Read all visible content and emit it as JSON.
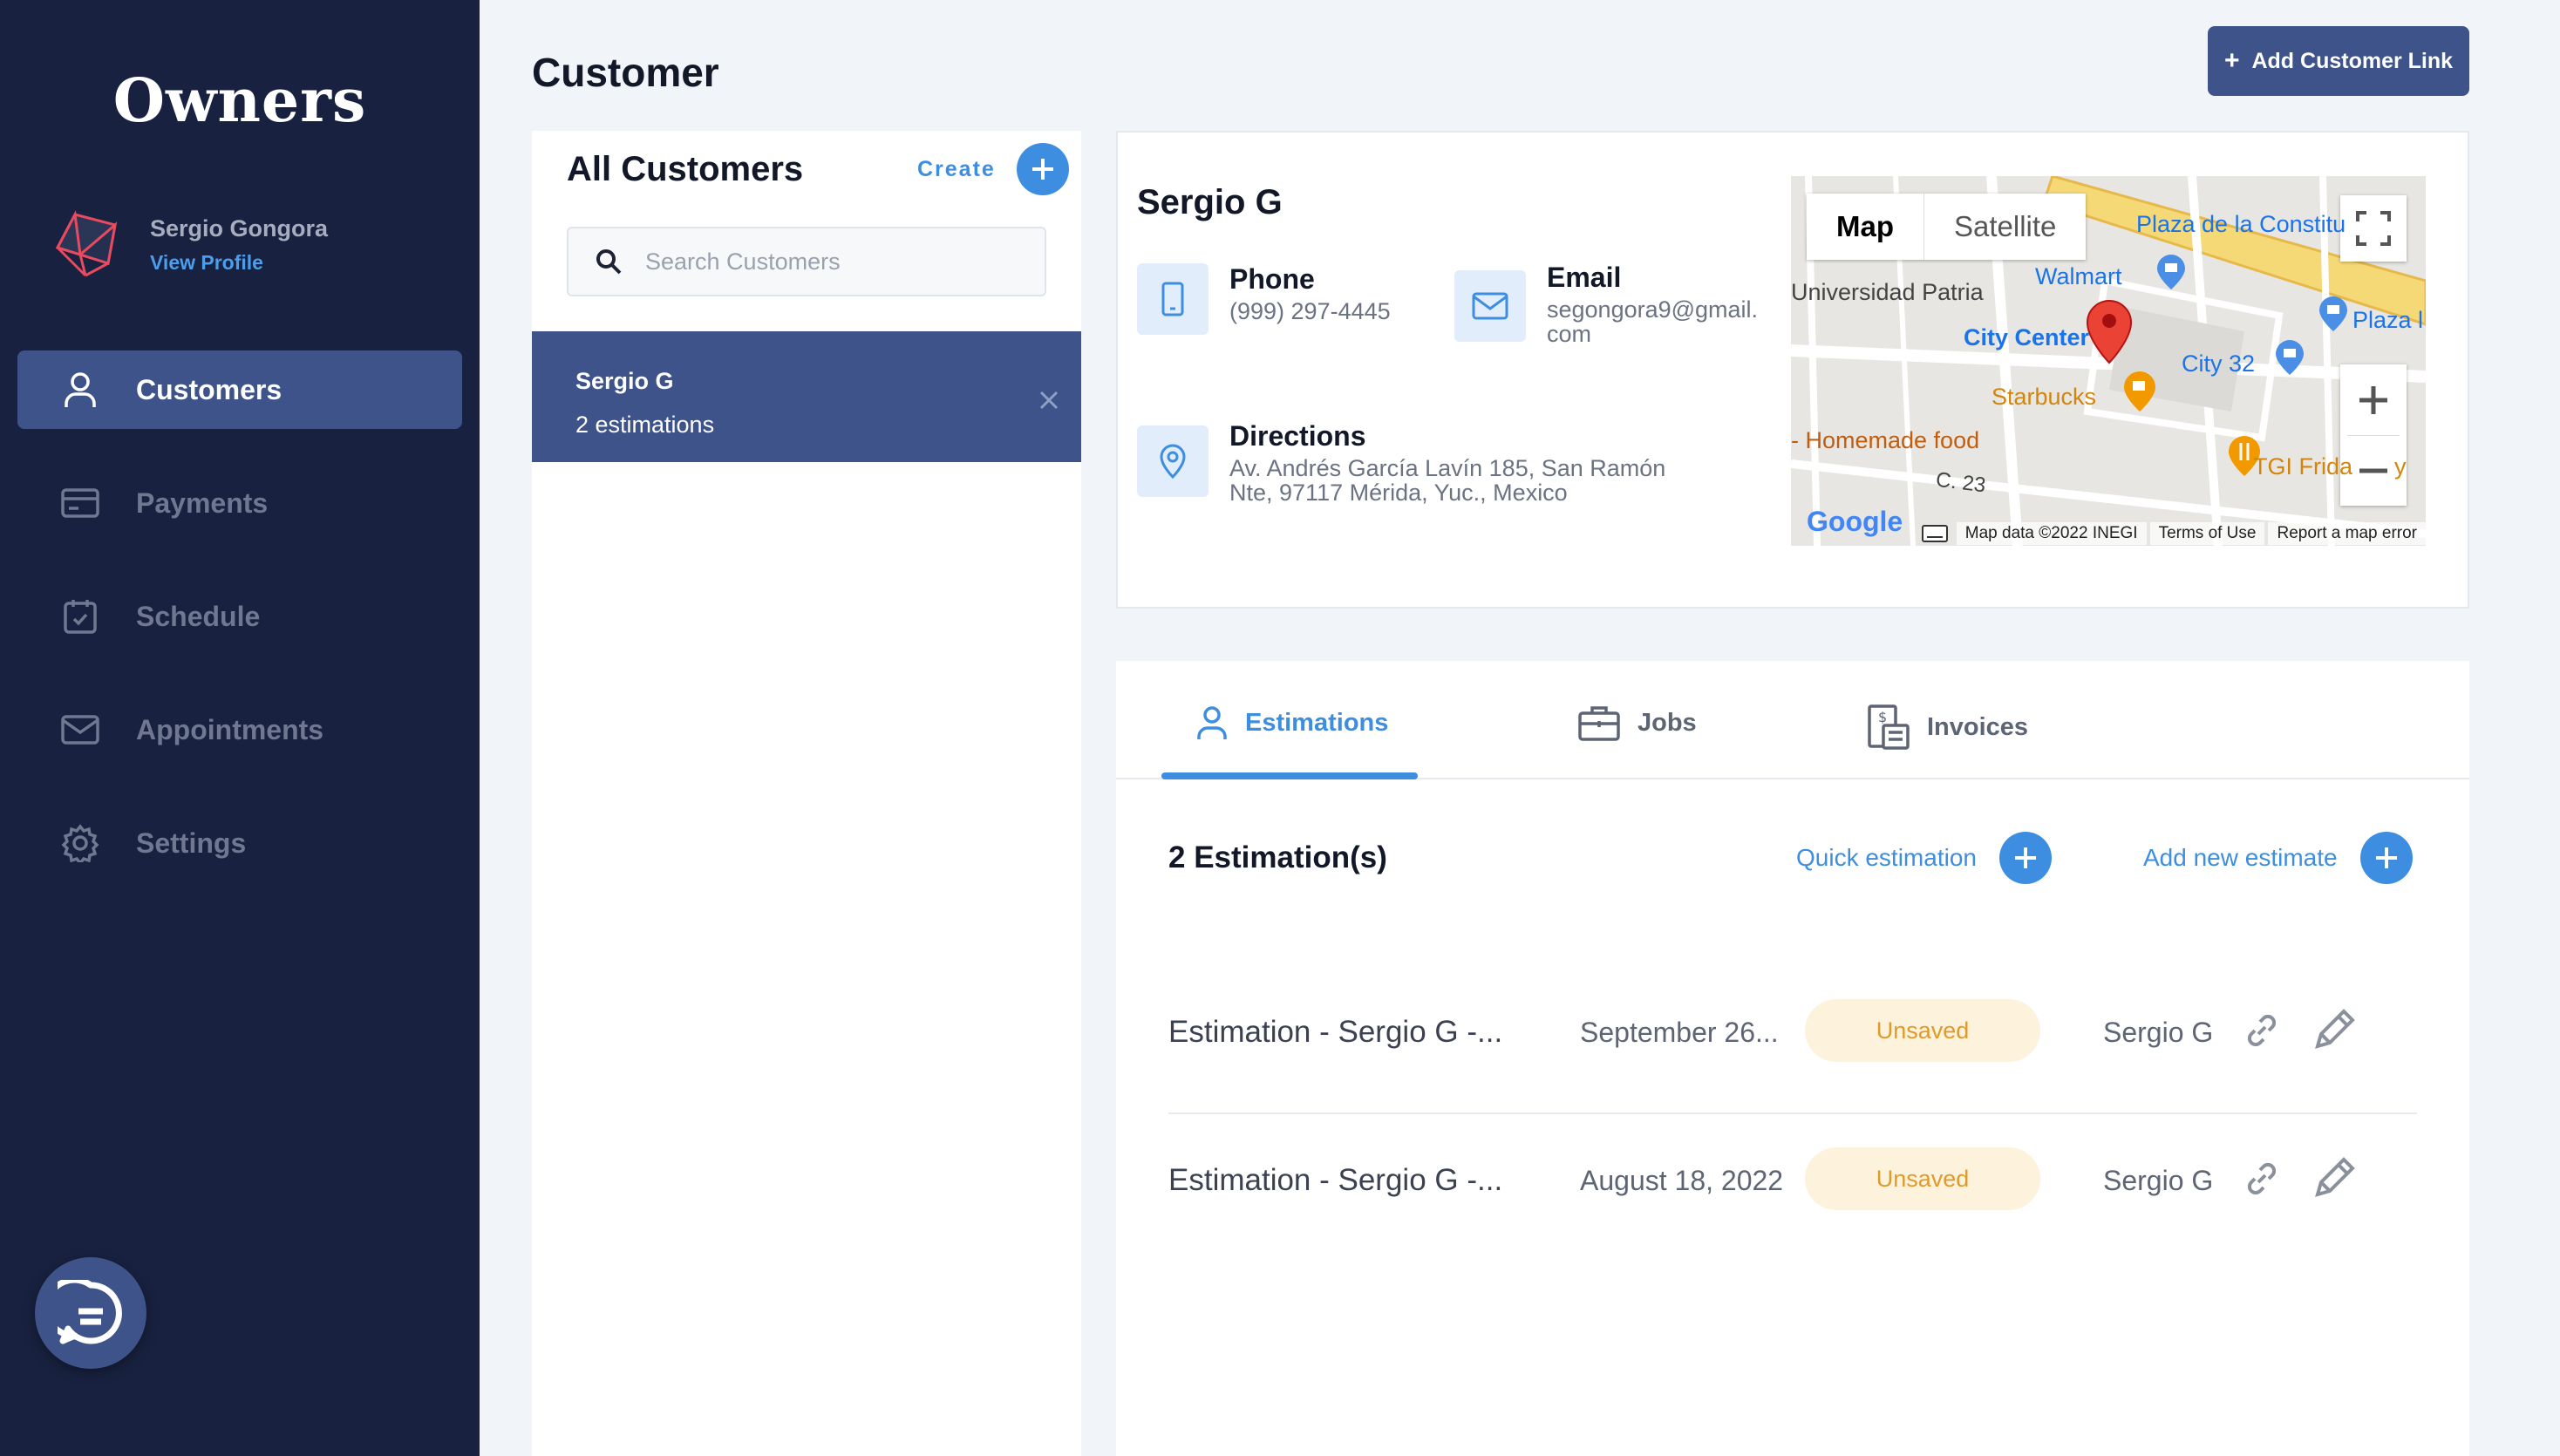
{
  "sidebar": {
    "brand": "Owners",
    "profile": {
      "name": "Sergio Gongora",
      "link": "View Profile"
    },
    "nav": [
      {
        "label": "Customers",
        "icon": "user-icon"
      },
      {
        "label": "Payments",
        "icon": "card-icon"
      },
      {
        "label": "Schedule",
        "icon": "calendar-icon"
      },
      {
        "label": "Appointments",
        "icon": "mail-icon"
      },
      {
        "label": "Settings",
        "icon": "gear-icon"
      }
    ]
  },
  "header": {
    "title": "Customer",
    "add_link_label": "Add Customer Link"
  },
  "customers_panel": {
    "title": "All Customers",
    "create_label": "Create",
    "search_placeholder": "Search Customers",
    "items": [
      {
        "name": "Sergio G",
        "subtitle": "2 estimations"
      }
    ]
  },
  "details": {
    "name": "Sergio G",
    "phone_label": "Phone",
    "phone": "(999) 297-4445",
    "email_label": "Email",
    "email_line1": "segongora9@gmail.",
    "email_line2": "com",
    "directions_label": "Directions",
    "address_line1": "Av. Andrés García Lavín 185, San Ramón",
    "address_line2": "Nte, 97117 Mérida, Yuc., Mexico"
  },
  "map": {
    "toggle_map": "Map",
    "toggle_satellite": "Satellite",
    "labels": {
      "plaza_constitucion": "Plaza de la Constitu",
      "walmart": "Walmart",
      "universidad": "Universidad Patria",
      "city_center": "City Center",
      "plaza": "Plaza l",
      "city32": "City 32",
      "starbucks": "Starbucks",
      "homemade": "- Homemade food",
      "tgi": "TGI Frida",
      "tgi_tail": "y",
      "street": "C. 23"
    },
    "footer": {
      "data": "Map data ©2022 INEGI",
      "terms": "Terms of Use",
      "report": "Report a map error"
    },
    "logo": "Google"
  },
  "tabs": [
    {
      "label": "Estimations"
    },
    {
      "label": "Jobs"
    },
    {
      "label": "Invoices"
    }
  ],
  "estimations": {
    "count_label": "2 Estimation(s)",
    "quick_label": "Quick estimation",
    "add_label": "Add new estimate",
    "rows": [
      {
        "title": "Estimation - Sergio G -...",
        "date": "September 26...",
        "status": "Unsaved",
        "owner": "Sergio G"
      },
      {
        "title": "Estimation - Sergio G -...",
        "date": "August 18, 2022",
        "status": "Unsaved",
        "owner": "Sergio G"
      }
    ]
  },
  "colors": {
    "sidebar_bg": "#18213f",
    "accent": "#3d5389",
    "link_blue": "#3d8ee0",
    "badge_bg": "#fdf2dc",
    "badge_text": "#e09a2b"
  }
}
